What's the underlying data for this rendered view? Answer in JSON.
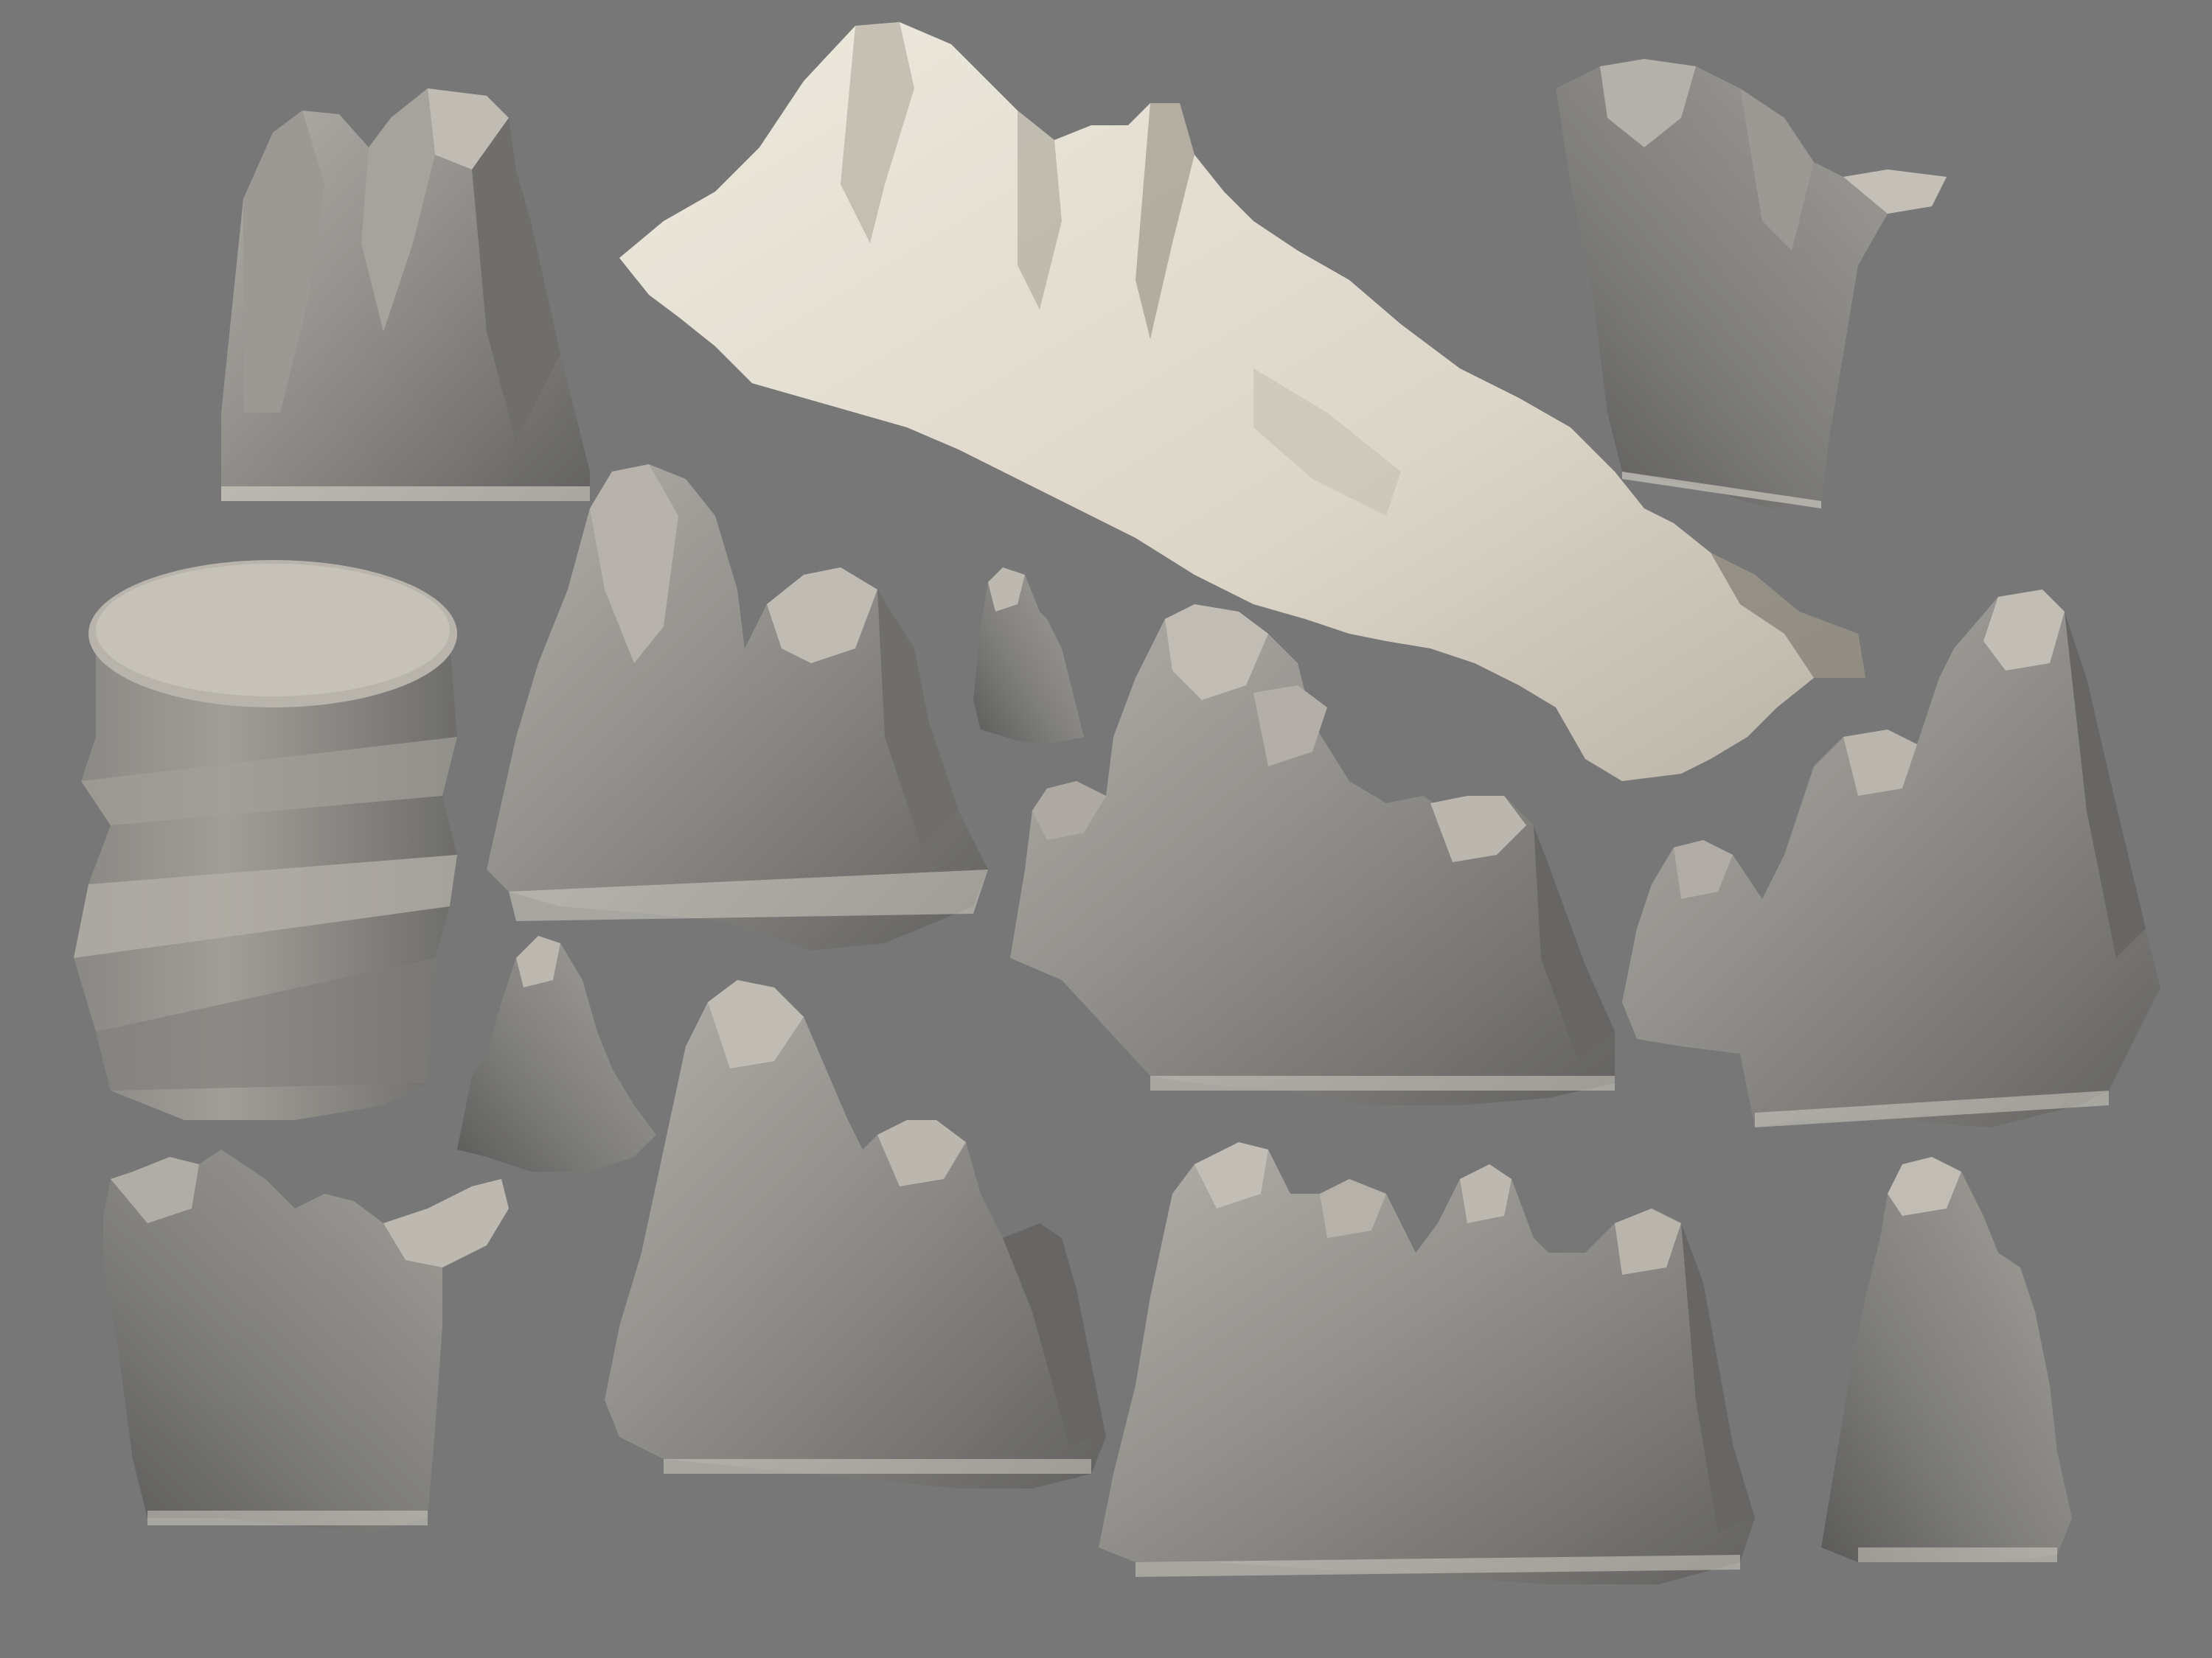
{
  "scene": {
    "background_color": "#777777",
    "rock_colors": {
      "highlight": "#c8c4bb",
      "light": "#a9a6a0",
      "mid": "#8f8d89",
      "dark": "#6b6a68",
      "shadow": "#555453",
      "base_fringe": "#e6e2da"
    },
    "snow_colors": {
      "light": "#ece7dc",
      "mid": "#d9d3c6",
      "shadow": "#9e998f"
    },
    "models": [
      {
        "name": "rock-cluster-top-left",
        "kind": "jagged-peaks"
      },
      {
        "name": "snowy-mountain-ridge",
        "kind": "snow-terrain"
      },
      {
        "name": "rock-cliff-top-right",
        "kind": "cliff-wall"
      },
      {
        "name": "flat-top-rock-pillar",
        "kind": "mesa"
      },
      {
        "name": "rock-twin-peaks-center-left",
        "kind": "jagged-peaks"
      },
      {
        "name": "rock-small-spire",
        "kind": "spire"
      },
      {
        "name": "rock-triple-peaks-center",
        "kind": "jagged-peaks"
      },
      {
        "name": "rock-peaks-right",
        "kind": "jagged-peaks"
      },
      {
        "name": "rock-small-spire-left",
        "kind": "spire"
      },
      {
        "name": "rock-cliff-bottom-left",
        "kind": "cliff-wall"
      },
      {
        "name": "rock-twin-peaks-bottom-center",
        "kind": "jagged-peaks"
      },
      {
        "name": "rock-row-bottom-center",
        "kind": "jagged-peaks"
      },
      {
        "name": "rock-single-peak-bottom-right",
        "kind": "spire"
      }
    ]
  }
}
